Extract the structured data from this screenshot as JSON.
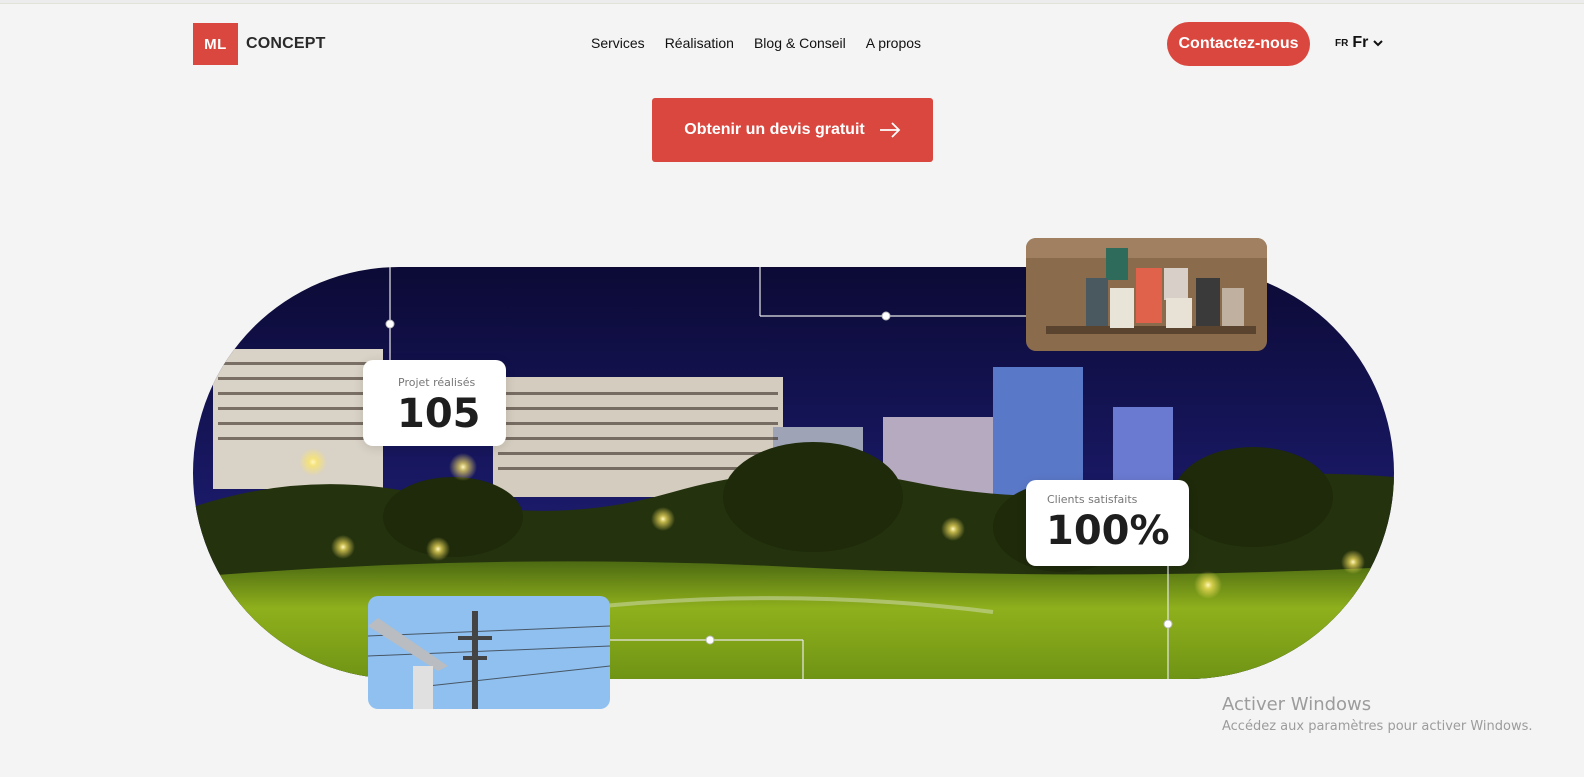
{
  "header": {
    "logo_mark": "ML",
    "logo_text": "CONCEPT",
    "nav": [
      "Services",
      "Réalisation",
      "Blog & Conseil",
      "A propos"
    ],
    "contact_label": "Contactez-nous",
    "lang_flag": "FR",
    "lang_current": "Fr"
  },
  "hero": {
    "cta_label": "Obtenir un devis gratuit",
    "stats": [
      {
        "label": "Projet réalisés",
        "value": "105"
      },
      {
        "label": "Clients satisfaits",
        "value": "100%"
      }
    ]
  },
  "watermark": {
    "title": "Activer Windows",
    "subtitle": "Accédez aux paramètres pour activer Windows."
  },
  "colors": {
    "brand": "#d9473e",
    "background": "#f4f4f4"
  },
  "icons": [
    "arrow-right-icon",
    "chevron-down-icon"
  ]
}
